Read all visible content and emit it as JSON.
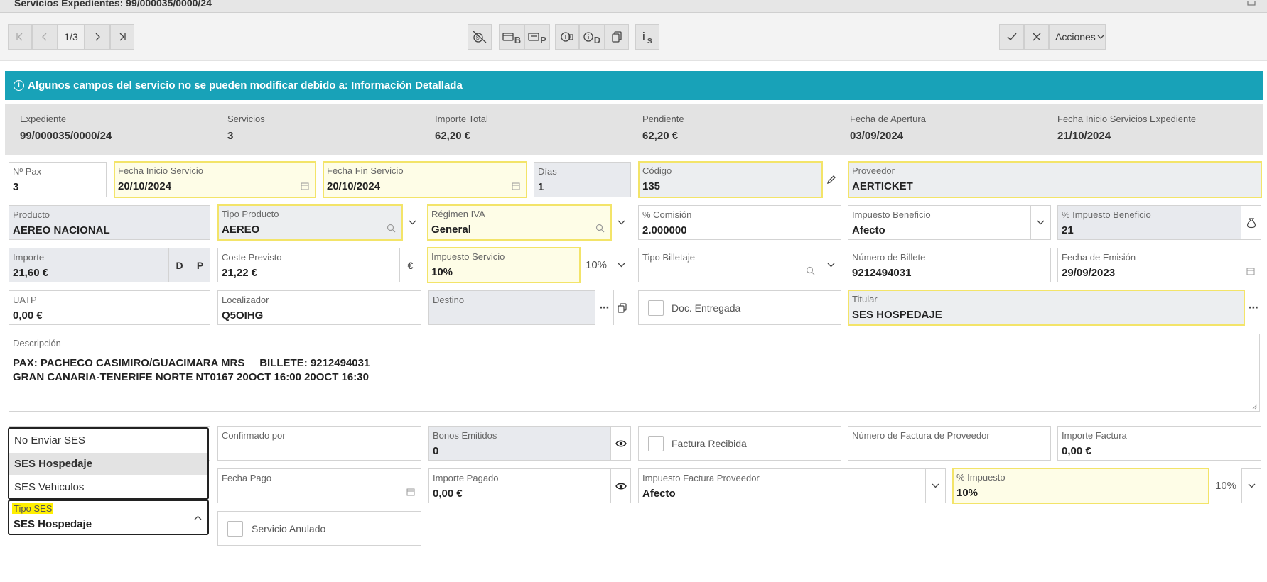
{
  "window": {
    "title": "Servicios Expedientes: 99/000035/0000/24"
  },
  "pager": {
    "current": "1/3"
  },
  "toolbar": {
    "btn_b_label": "B",
    "btn_p_label": "P",
    "btn_d_label": "D",
    "btn_s_label": "s",
    "btn_i_label": "i",
    "acciones_label": "Acciones"
  },
  "banner": {
    "text": "Algunos campos del servicio no se pueden modificar debido a: Información Detallada"
  },
  "summary": [
    {
      "label": "Expediente",
      "value": "99/000035/0000/24"
    },
    {
      "label": "Servicios",
      "value": "3"
    },
    {
      "label": "Importe Total",
      "value": "62,20 €"
    },
    {
      "label": "Pendiente",
      "value": "62,20 €"
    },
    {
      "label": "Fecha de Apertura",
      "value": "03/09/2024"
    },
    {
      "label": "Fecha Inicio Servicios Expediente",
      "value": "21/10/2024"
    }
  ],
  "form": {
    "npax": {
      "label": "Nº Pax",
      "value": "3"
    },
    "fecha_inicio": {
      "label": "Fecha Inicio Servicio",
      "value": "20/10/2024"
    },
    "fecha_fin": {
      "label": "Fecha Fin Servicio",
      "value": "20/10/2024"
    },
    "dias": {
      "label": "Días",
      "value": "1"
    },
    "codigo": {
      "label": "Código",
      "value": "135"
    },
    "proveedor": {
      "label": "Proveedor",
      "value": "AERTICKET"
    },
    "producto": {
      "label": "Producto",
      "value": "AEREO NACIONAL"
    },
    "tipo_producto": {
      "label": "Tipo Producto",
      "value": "AEREO"
    },
    "regimen_iva": {
      "label": "Régimen IVA",
      "value": "General"
    },
    "comision": {
      "label": "% Comisión",
      "value": "2.000000"
    },
    "impuesto_beneficio": {
      "label": "Impuesto Beneficio",
      "value": "Afecto"
    },
    "pct_impuesto_beneficio": {
      "label": "% Impuesto Beneficio",
      "value": "21"
    },
    "importe": {
      "label": "Importe",
      "value": "21,60 €",
      "btn_d": "D",
      "btn_p": "P"
    },
    "coste_previsto": {
      "label": "Coste Previsto",
      "value": "21,22 €",
      "currency": "€"
    },
    "impuesto_servicio": {
      "label": "Impuesto Servicio",
      "value": "10%",
      "side": "10%"
    },
    "tipo_billetaje": {
      "label": "Tipo Billetaje",
      "value": ""
    },
    "numero_billete": {
      "label": "Número de Billete",
      "value": "9212494031"
    },
    "fecha_emision": {
      "label": "Fecha de Emisión",
      "value": "29/09/2023"
    },
    "uatp": {
      "label": "UATP",
      "value": "0,00 €"
    },
    "localizador": {
      "label": "Localizador",
      "value": "Q5OIHG"
    },
    "destino": {
      "label": "Destino",
      "value": ""
    },
    "doc_entregada": {
      "label": "Doc. Entregada"
    },
    "titular": {
      "label": "Titular",
      "value": "SES HOSPEDAJE"
    },
    "descripcion": {
      "label": "Descripción",
      "line1": "PAX: PACHECO CASIMIRO/GUACIMARA MRS     BILLETE: 9212494031",
      "line2": "GRAN CANARIA-TENERIFE NORTE NT0167 20OCT 16:00 20OCT 16:30"
    },
    "confirmado_por": {
      "label": "Confirmado por",
      "value": ""
    },
    "bonos_emitidos": {
      "label": "Bonos Emitidos",
      "value": "0"
    },
    "factura_recibida": {
      "label": "Factura Recibida"
    },
    "num_factura_proveedor": {
      "label": "Número de Factura de Proveedor",
      "value": ""
    },
    "importe_factura": {
      "label": "Importe Factura",
      "value": "0,00 €"
    },
    "fecha_pago": {
      "label": "Fecha Pago",
      "value": ""
    },
    "importe_pagado": {
      "label": "Importe Pagado",
      "value": "0,00 €"
    },
    "impuesto_factura_proveedor": {
      "label": "Impuesto Factura Proveedor",
      "value": "Afecto"
    },
    "pct_impuesto": {
      "label": "% Impuesto",
      "value": "10%",
      "side": "10%"
    },
    "servicio_anulado": {
      "label": "Servicio Anulado"
    },
    "tipo_ses": {
      "label": "Tipo SES",
      "value": "SES Hospedaje",
      "options": [
        "No Enviar SES",
        "SES Hospedaje",
        "SES Vehiculos"
      ]
    }
  },
  "colors": {
    "banner": "#18a2b8",
    "highlight_border": "#f3e469",
    "highlight_bg": "#fefde7",
    "readonly_bg": "#e8eaee",
    "annotation": "#ffef00"
  }
}
